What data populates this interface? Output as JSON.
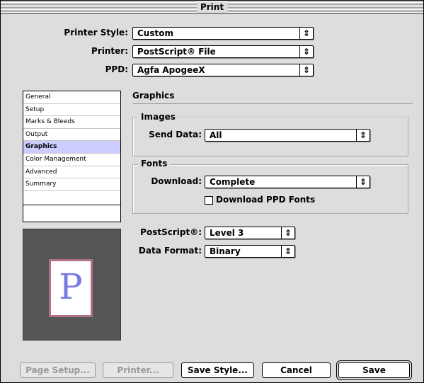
{
  "window": {
    "title": "Print"
  },
  "printer_style": {
    "label": "Printer Style:",
    "value": "Custom"
  },
  "printer": {
    "label": "Printer:",
    "value": "PostScript® File"
  },
  "ppd": {
    "label": "PPD:",
    "value": "Agfa ApogeeX"
  },
  "sidebar": {
    "items": [
      {
        "label": "General"
      },
      {
        "label": "Setup"
      },
      {
        "label": "Marks & Bleeds"
      },
      {
        "label": "Output"
      },
      {
        "label": "Graphics"
      },
      {
        "label": "Color Management"
      },
      {
        "label": "Advanced"
      },
      {
        "label": "Summary"
      }
    ],
    "selected": "Graphics"
  },
  "preview": {
    "letter": "P"
  },
  "panel": {
    "title": "Graphics",
    "images": {
      "title": "Images",
      "send_data_label": "Send Data:",
      "send_data_value": "All"
    },
    "fonts": {
      "title": "Fonts",
      "download_label": "Download:",
      "download_value": "Complete",
      "download_ppd_label": "Download PPD Fonts",
      "download_ppd_checked": false
    },
    "postscript": {
      "label": "PostScript®:",
      "value": "Level 3"
    },
    "data_format": {
      "label": "Data Format:",
      "value": "Binary"
    }
  },
  "buttons": {
    "page_setup": "Page Setup...",
    "printer": "Printer...",
    "save_style": "Save Style...",
    "cancel": "Cancel",
    "save": "Save"
  }
}
